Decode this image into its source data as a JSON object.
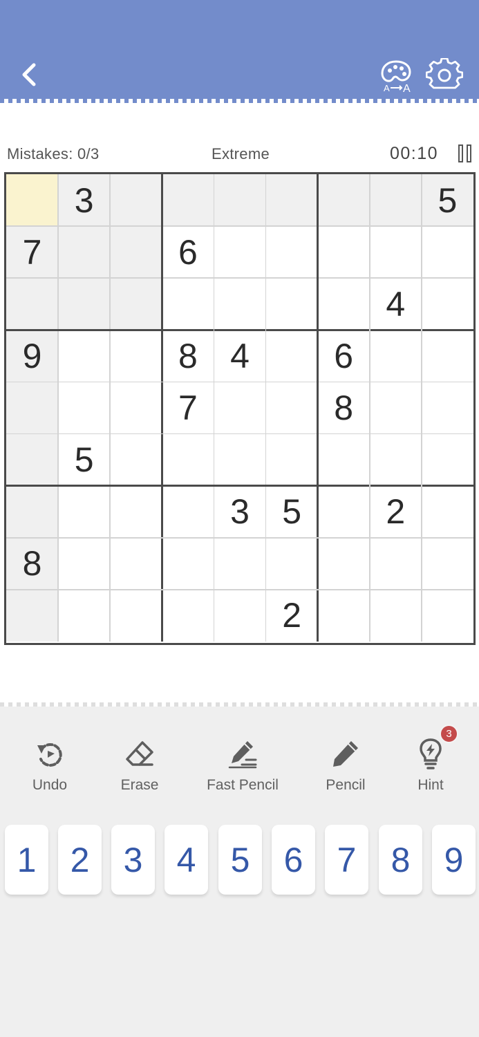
{
  "status": {
    "mistakes": "Mistakes: 0/3",
    "difficulty": "Extreme",
    "timer": "00:10"
  },
  "icons": {
    "back": "chevron-left-icon",
    "theme": "palette-icon",
    "settings": "gear-icon",
    "pause": "pause-icon"
  },
  "colors": {
    "header": "#738ccb",
    "selected_cell": "#faf3cf",
    "highlight_cell": "#f0f0f0",
    "number_key": "#3558a8",
    "hint_badge": "#c44b4b"
  },
  "board": {
    "selected": [
      0,
      0
    ],
    "rows": [
      [
        "",
        "3",
        "",
        "",
        "",
        "",
        "",
        "",
        "5"
      ],
      [
        "7",
        "",
        "",
        "6",
        "",
        "",
        "",
        "",
        ""
      ],
      [
        "",
        "",
        "",
        "",
        "",
        "",
        "",
        "4",
        ""
      ],
      [
        "9",
        "",
        "",
        "8",
        "4",
        "",
        "6",
        "",
        ""
      ],
      [
        "",
        "",
        "",
        "7",
        "",
        "",
        "8",
        "",
        ""
      ],
      [
        "",
        "5",
        "",
        "",
        "",
        "",
        "",
        "",
        ""
      ],
      [
        "",
        "",
        "",
        "",
        "3",
        "5",
        "",
        "2",
        ""
      ],
      [
        "8",
        "",
        "",
        "",
        "",
        "",
        "",
        "",
        ""
      ],
      [
        "",
        "",
        "",
        "",
        "",
        "2",
        "",
        "",
        ""
      ]
    ]
  },
  "tools": [
    {
      "label": "Undo",
      "icon": "undo-icon"
    },
    {
      "label": "Erase",
      "icon": "eraser-icon"
    },
    {
      "label": "Fast Pencil",
      "icon": "fast-pencil-icon"
    },
    {
      "label": "Pencil",
      "icon": "pencil-icon"
    },
    {
      "label": "Hint",
      "icon": "lightbulb-icon"
    }
  ],
  "hint_count": "3",
  "numbers": [
    "1",
    "2",
    "3",
    "4",
    "5",
    "6",
    "7",
    "8",
    "9"
  ]
}
